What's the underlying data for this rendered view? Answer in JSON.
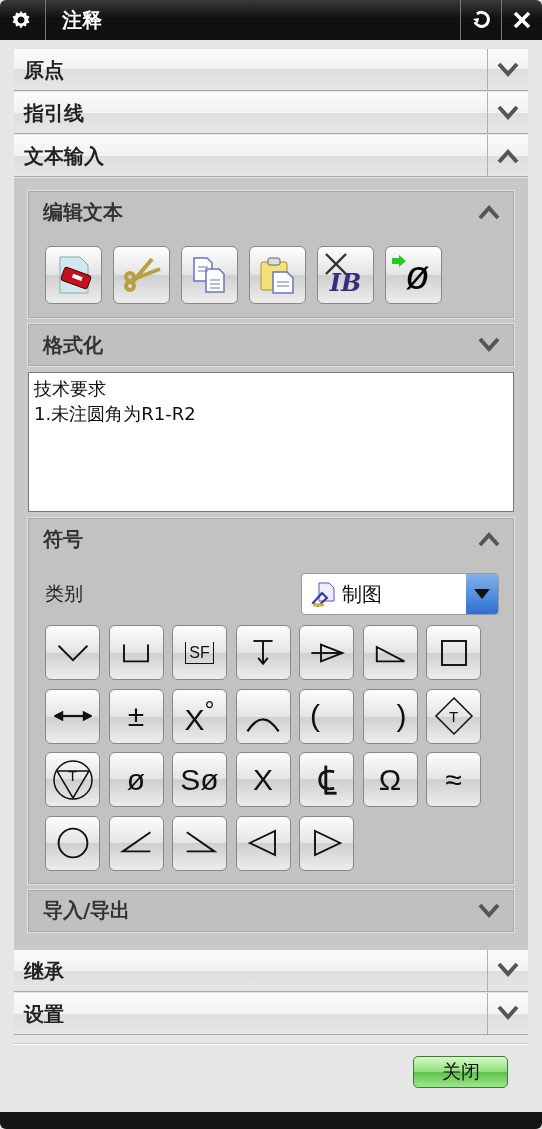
{
  "window": {
    "title": "注释"
  },
  "sections": [
    {
      "label": "原点",
      "expanded": false
    },
    {
      "label": "指引线",
      "expanded": false
    },
    {
      "label": "文本输入",
      "expanded": true,
      "groups": [
        {
          "kind": "tools",
          "label": "编辑文本",
          "expanded": true,
          "tools": [
            {
              "kind": "erase"
            },
            {
              "kind": "cut"
            },
            {
              "kind": "copy"
            },
            {
              "kind": "paste"
            },
            {
              "kind": "clear-format",
              "text": "IB"
            },
            {
              "kind": "insert-symbol",
              "text": "ø"
            }
          ]
        },
        {
          "kind": "header",
          "label": "格式化",
          "expanded": false
        },
        {
          "kind": "editor",
          "text": "技术要求\n1.未注圆角为R1-R2"
        },
        {
          "kind": "symbols",
          "label": "符号",
          "expanded": true,
          "category": {
            "label": "类别",
            "value": "制图"
          },
          "symbols": [
            {
              "kind": "icon"
            },
            {
              "kind": "icon"
            },
            {
              "kind": "boxed",
              "text": "SF"
            },
            {
              "kind": "icon"
            },
            {
              "kind": "icon"
            },
            {
              "kind": "icon"
            },
            {
              "kind": "icon"
            },
            {
              "kind": "icon"
            },
            {
              "kind": "text",
              "text": "±"
            },
            {
              "kind": "text",
              "text": "X$^{°}$"
            },
            {
              "kind": "icon"
            },
            {
              "kind": "text",
              "text": "("
            },
            {
              "kind": "text",
              "text": ")"
            },
            {
              "kind": "diamond",
              "text": "T"
            },
            {
              "kind": "circle",
              "text": "T"
            },
            {
              "kind": "text",
              "text": "ø"
            },
            {
              "kind": "text",
              "text": "Sø"
            },
            {
              "kind": "text",
              "text": "X"
            },
            {
              "kind": "icon"
            },
            {
              "kind": "text",
              "text": "Ω"
            },
            {
              "kind": "text",
              "text": "≈"
            },
            {
              "kind": "icon"
            },
            {
              "kind": "icon"
            },
            {
              "kind": "icon"
            },
            {
              "kind": "icon"
            },
            {
              "kind": "icon"
            }
          ]
        },
        {
          "kind": "header",
          "label": "导入/导出",
          "expanded": false
        }
      ]
    },
    {
      "label": "继承",
      "expanded": false
    },
    {
      "label": "设置",
      "expanded": false
    }
  ],
  "close_button": "关闭"
}
